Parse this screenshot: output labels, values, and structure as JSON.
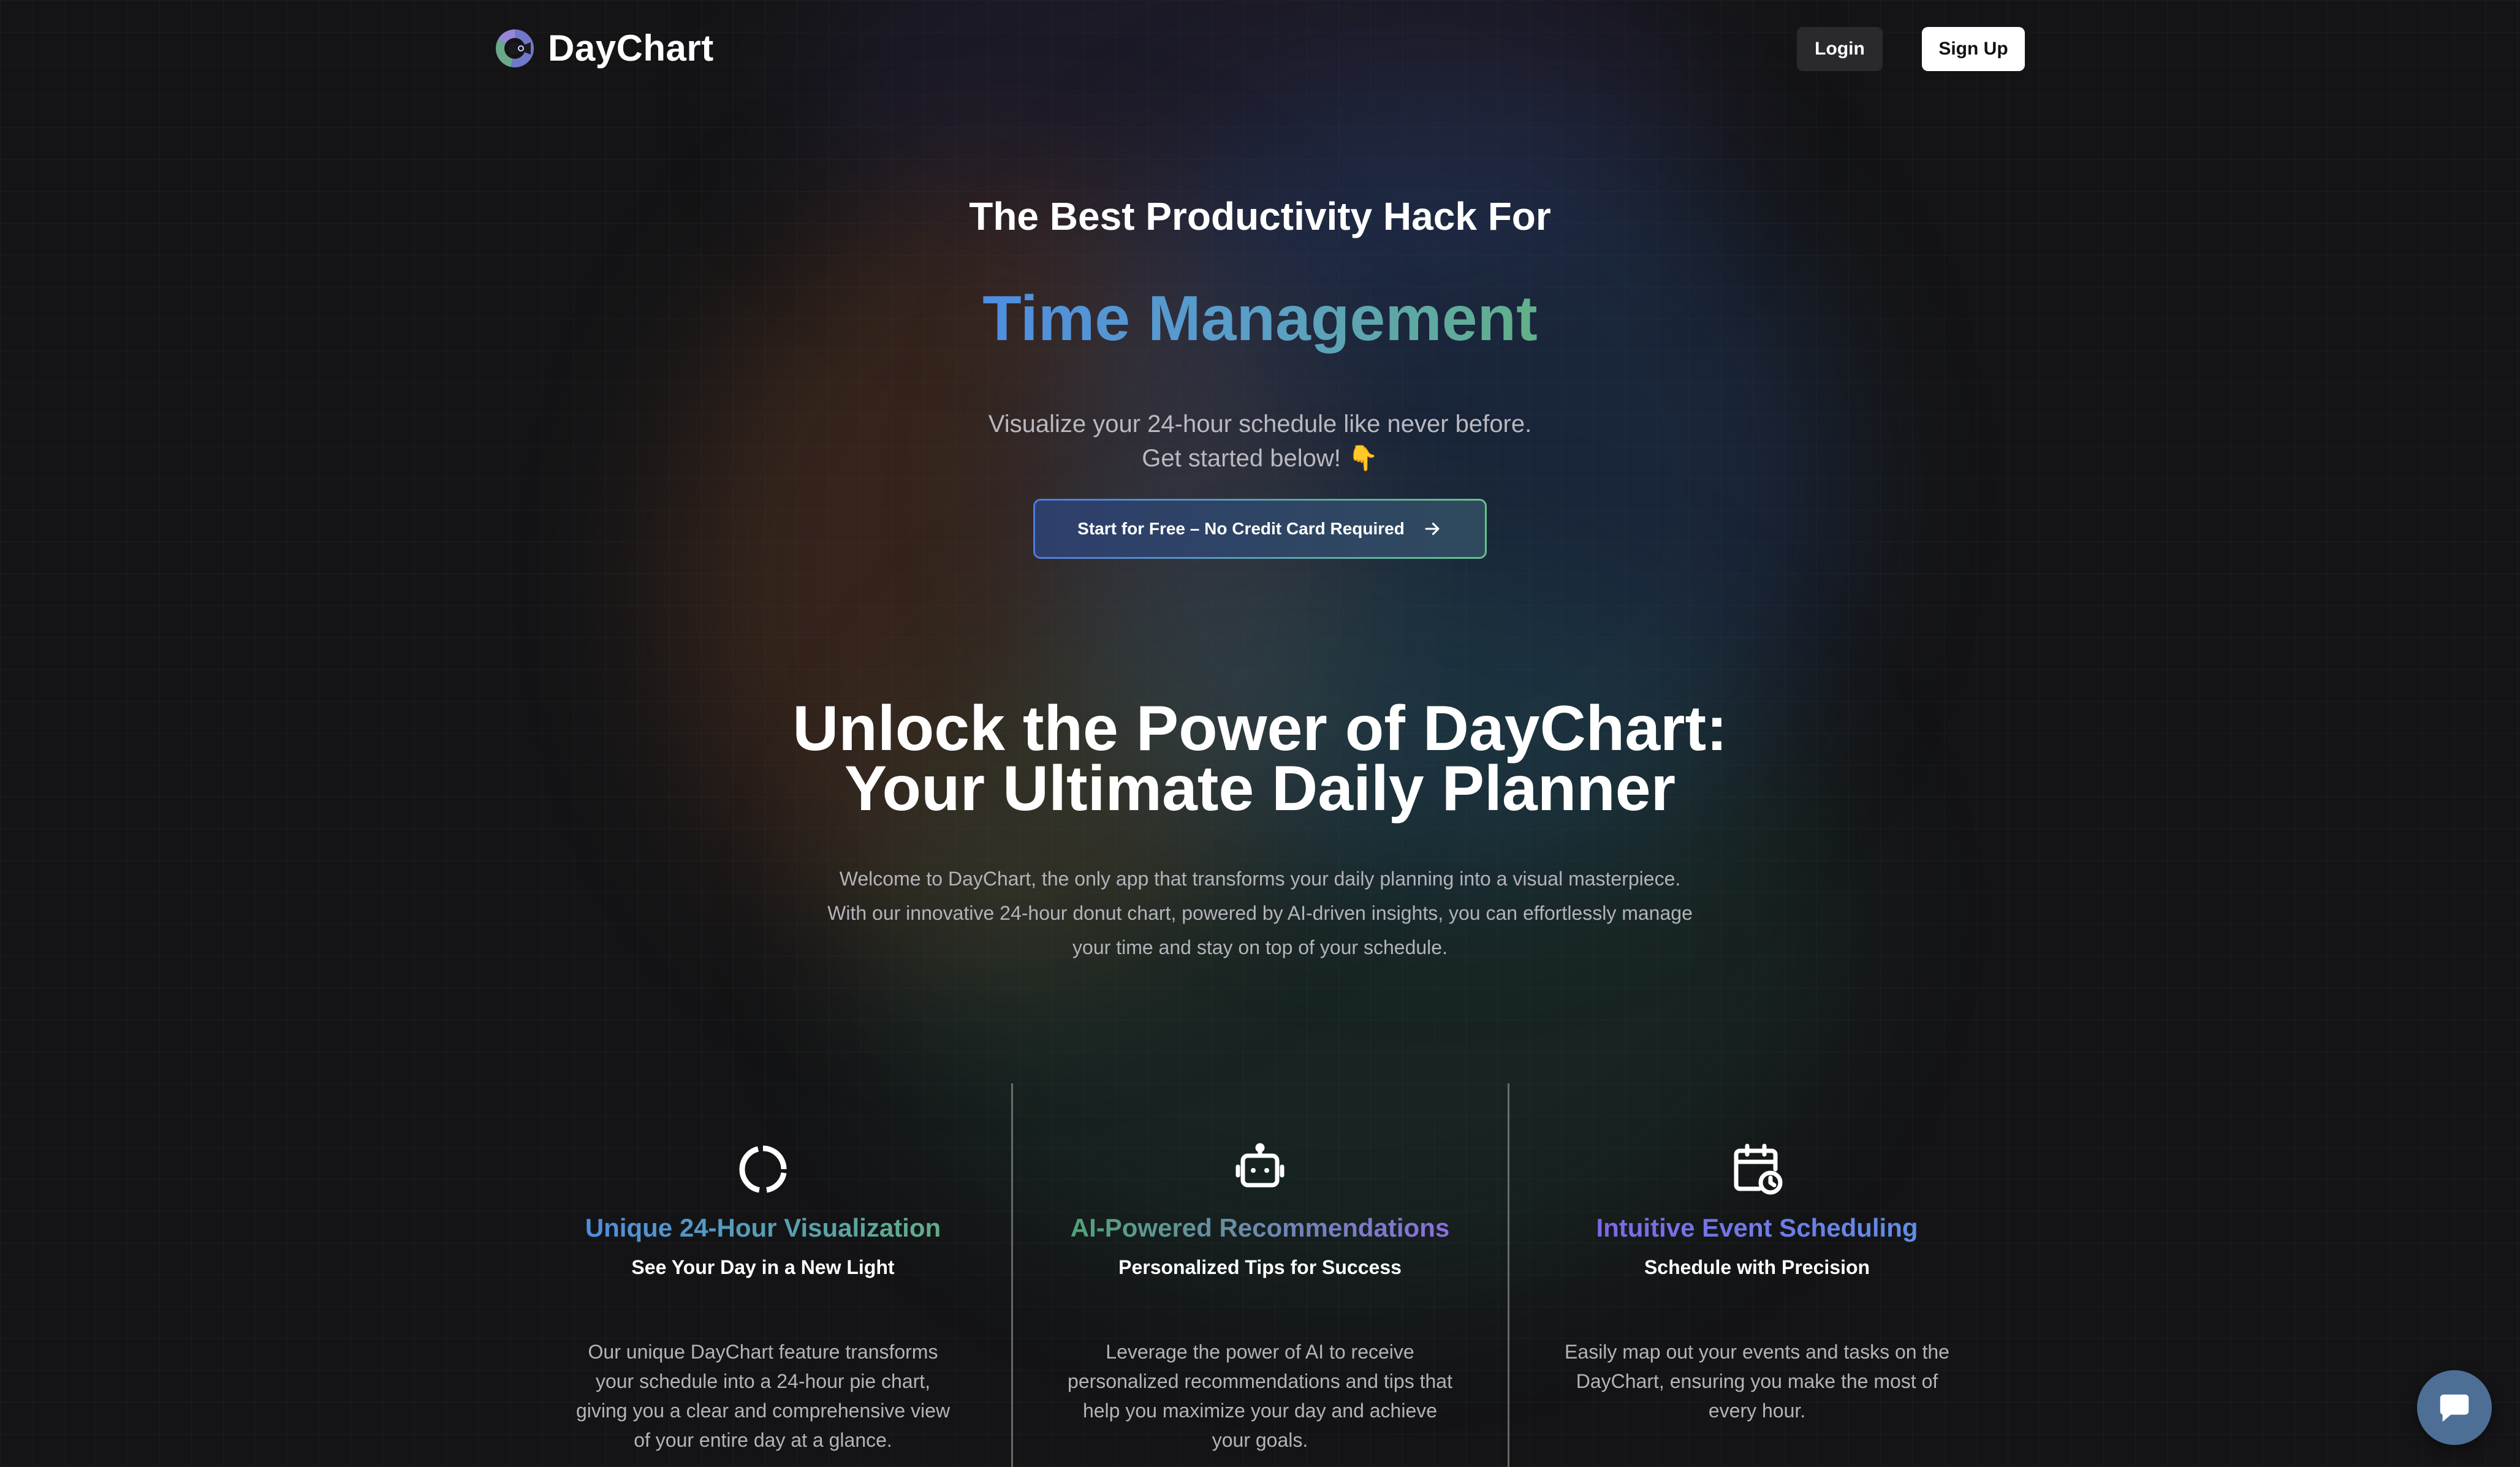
{
  "brand": {
    "name": "DayChart",
    "logo_icon": "donut-logo-icon"
  },
  "nav": {
    "login_label": "Login",
    "signup_label": "Sign Up"
  },
  "hero": {
    "kicker": "The Best Productivity Hack For",
    "headline": "Time Management",
    "subtitle_line1": "Visualize your 24-hour schedule like never before.",
    "subtitle_line2": "Get started below! 👇",
    "cta_label": "Start for Free – No Credit Card Required",
    "cta_icon": "arrow-right-icon"
  },
  "section": {
    "title_line1": "Unlock the Power of DayChart:",
    "title_line2": "Your Ultimate Daily Planner",
    "body_line1": "Welcome to DayChart, the only app that transforms your daily planning into a visual masterpiece.",
    "body_line2": "With our innovative 24-hour donut chart, powered by AI-driven insights, you can effortlessly manage",
    "body_line3": "your time and stay on top of your schedule."
  },
  "features": [
    {
      "icon": "donut-chart-icon",
      "title": "Unique 24-Hour Visualization",
      "subtitle": "See Your Day in a New Light",
      "body": "Our unique DayChart feature transforms your schedule into a 24-hour pie chart, giving you a clear and comprehensive view of your entire day at a glance."
    },
    {
      "icon": "robot-icon",
      "title": "AI-Powered Recommendations",
      "subtitle": "Personalized Tips for Success",
      "body": "Leverage the power of AI to receive personalized recommendations and tips that help you maximize your day and achieve your goals."
    },
    {
      "icon": "calendar-clock-icon",
      "title": "Intuitive Event Scheduling",
      "subtitle": "Schedule with Precision",
      "body": "Easily map out your events and tasks on the DayChart, ensuring you make the most of every hour."
    }
  ],
  "chat_widget": {
    "icon": "chat-bubble-icon"
  },
  "colors": {
    "background": "#141416",
    "accent_blue": "#4f8de0",
    "accent_green": "#62b089",
    "accent_purple": "#8a6fe0",
    "chat_button": "#4d6f96"
  }
}
